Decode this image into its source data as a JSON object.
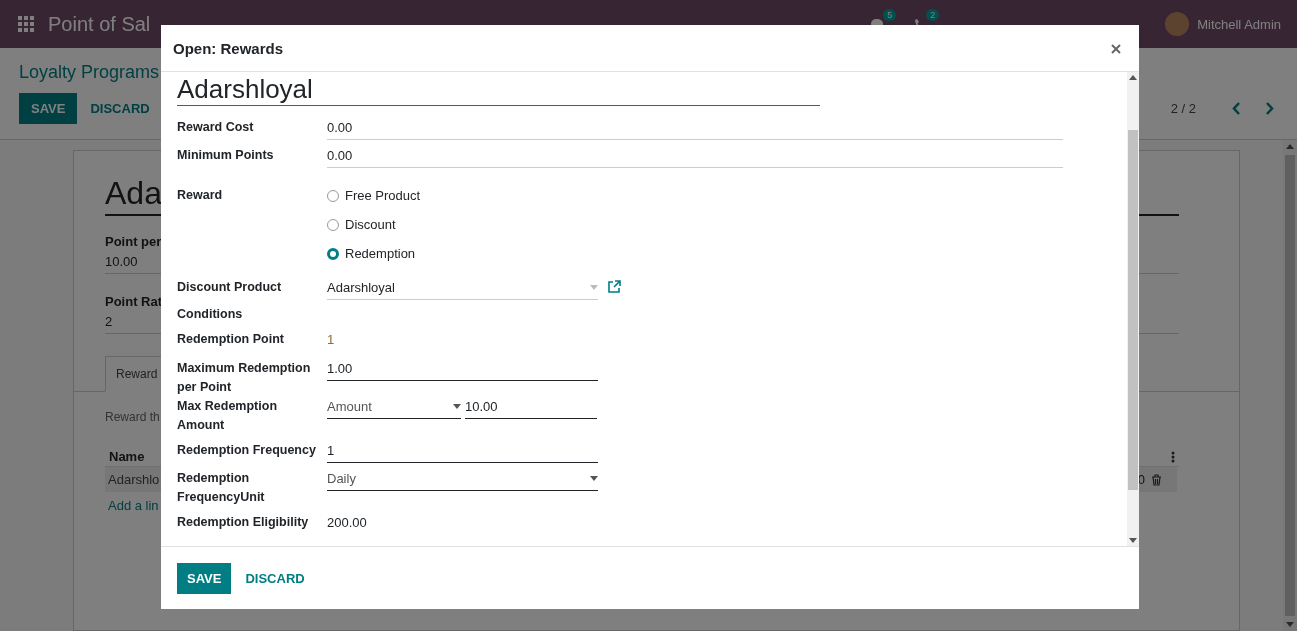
{
  "navbar": {
    "app_title": "Point of Sal",
    "messages_badge": "5",
    "activities_badge": "2",
    "user": "Mitchell Admin"
  },
  "control_panel": {
    "breadcrumb": "Loyalty Programs",
    "buttons": [
      "SAVE",
      "DISCARD"
    ],
    "pager": "2 / 2"
  },
  "sheet": {
    "title": "Ada",
    "fields": [
      {
        "label": "Point per",
        "value": "10.00"
      },
      {
        "label": "Point Rat",
        "value": "2"
      }
    ],
    "tabs": [
      {
        "label": "Reward",
        "selected": true
      }
    ],
    "note": "Reward th",
    "table": {
      "columns": [
        "Name"
      ],
      "rows": [
        {
          "name": "Adarshlo",
          "column_2": "0"
        }
      ],
      "add_line": "Add a lin"
    }
  },
  "dialog": {
    "title": "Open: Rewards",
    "name": "Adarshloyal",
    "fields": [
      {
        "kind": "input",
        "label": "Reward Cost",
        "value": "0.00",
        "wide": true,
        "required": false
      },
      {
        "kind": "input",
        "label": "Minimum Points",
        "value": "0.00",
        "wide": true,
        "required": false
      },
      {
        "kind": "radio",
        "label": "Reward",
        "options": [
          {
            "label": "Free Product",
            "selected": false
          },
          {
            "label": "Discount",
            "selected": false
          },
          {
            "label": "Redemption",
            "selected": true
          }
        ]
      },
      {
        "kind": "many2one",
        "label": "Discount Product",
        "value": "Adarshloyal",
        "required": false
      },
      {
        "kind": "section",
        "label": "Conditions"
      },
      {
        "kind": "readonly",
        "label": "Redemption Point",
        "value": "1"
      },
      {
        "kind": "input",
        "label": "Maximum Redemption per Point",
        "value": "1.00",
        "wide": false,
        "required": true
      },
      {
        "kind": "pair",
        "label": "Max Redemption Amount",
        "select": "Amount",
        "value": "10.00",
        "required": true
      },
      {
        "kind": "input",
        "label": "Redemption Frequency",
        "value": "1",
        "wide": false,
        "required": true
      },
      {
        "kind": "select",
        "label": "Redemption FrequencyUnit",
        "value": "Daily",
        "required": true
      },
      {
        "kind": "text",
        "label": "Redemption Eligibility",
        "value": "200.00"
      }
    ],
    "buttons": [
      "SAVE",
      "DISCARD"
    ]
  }
}
